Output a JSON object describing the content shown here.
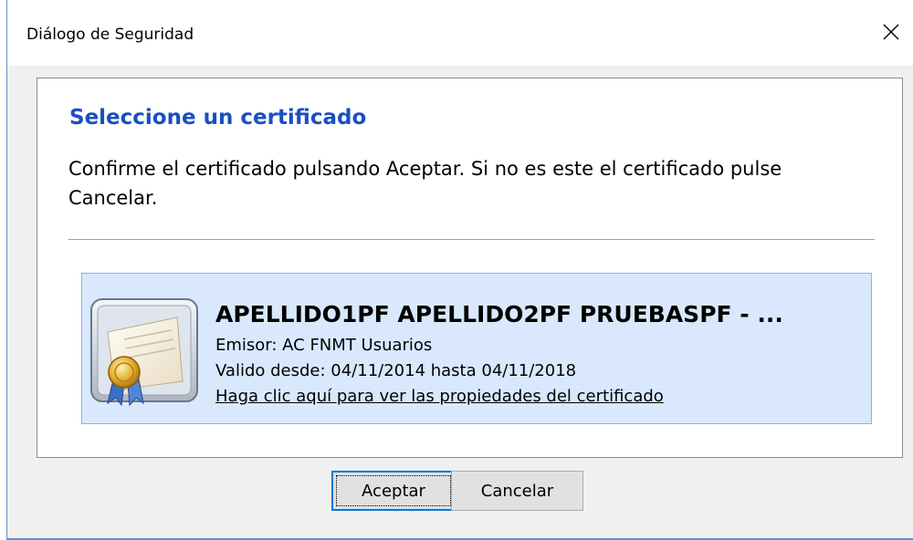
{
  "window": {
    "title": "Diálogo de Seguridad",
    "close_icon": "close-icon"
  },
  "content": {
    "heading": "Seleccione un certificado",
    "description": "Confirme el certificado pulsando Aceptar. Si no es este el certificado pulse Cancelar."
  },
  "certificate": {
    "icon": "certificate-icon",
    "name": "APELLIDO1PF APELLIDO2PF PRUEBASPF - ...",
    "issuer": "Emisor: AC FNMT Usuarios",
    "validity": "Valido desde: 04/11/2014 hasta 04/11/2018",
    "properties_link": "Haga clic aquí para ver las propiedades del certificado"
  },
  "buttons": {
    "accept_label": "Aceptar",
    "cancel_label": "Cancelar"
  },
  "colors": {
    "heading": "#1a4fc2",
    "selection_background": "#d9e8fc",
    "selection_border": "#88b4e6",
    "window_border": "#5b8ed6",
    "focus_border": "#0078d7"
  }
}
